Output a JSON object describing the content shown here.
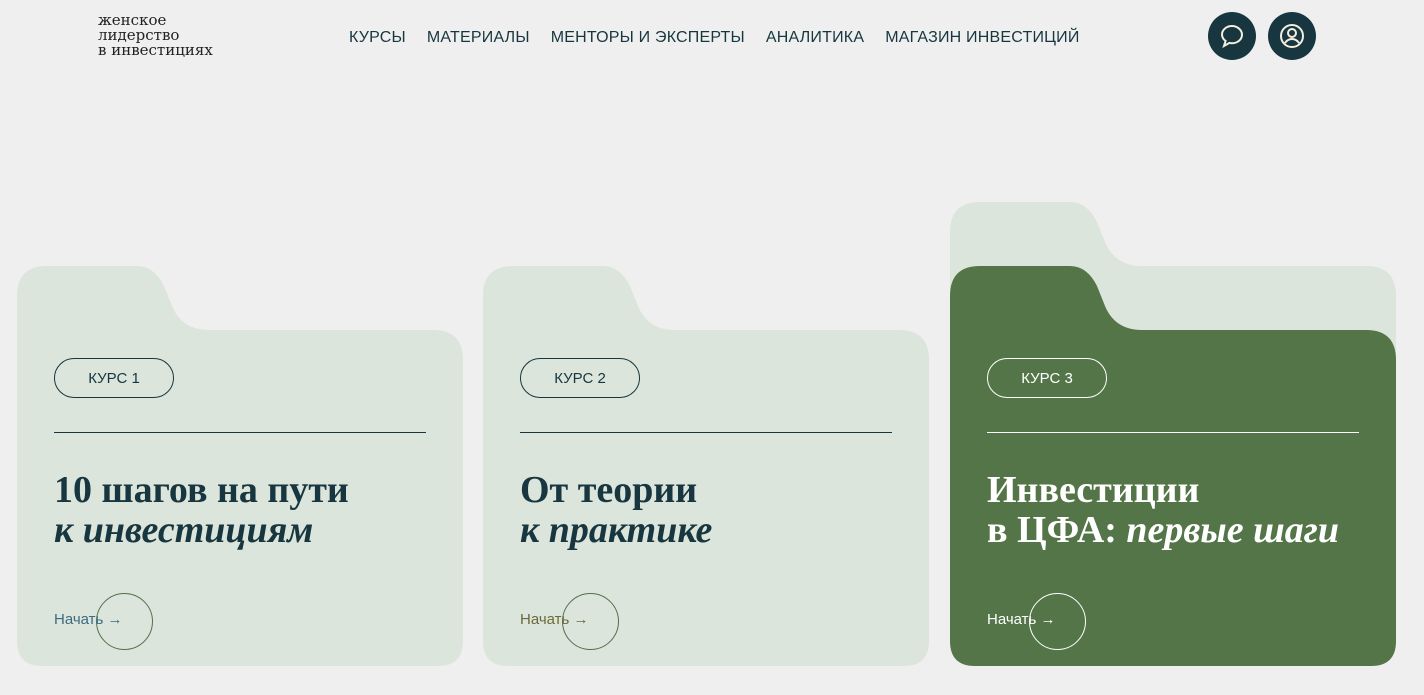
{
  "logo": {
    "line1": "женское",
    "line2": "лидерство",
    "line3": "в инвестициях"
  },
  "nav": [
    "КУРСЫ",
    "МАТЕРИАЛЫ",
    "МЕНТОРЫ И ЭКСПЕРТЫ",
    "АНАЛИТИКА",
    "МАГАЗИН ИНВЕСТИЦИЙ"
  ],
  "header": {
    "chat_icon": "chat-bubble-icon",
    "user_icon": "user-circle-icon"
  },
  "colors": {
    "dark": "#17363f",
    "card_light": "#dce5db",
    "card_active": "#537548"
  },
  "cards": [
    {
      "badge": "КУРС 1",
      "title_line1": "10 шагов на пути",
      "title_line2": "к инвестициям",
      "title_line2_pre": "",
      "start": "Начать →"
    },
    {
      "badge": "КУРС 2",
      "title_line1": "От теории",
      "title_line2": "к практике",
      "title_line2_pre": "",
      "start": "Начать →"
    },
    {
      "badge": "КУРС 3",
      "title_line1": "Инвестиции",
      "title_line2_pre": "в ЦФА: ",
      "title_line2": "первые шаги",
      "start": "Начать →"
    }
  ]
}
